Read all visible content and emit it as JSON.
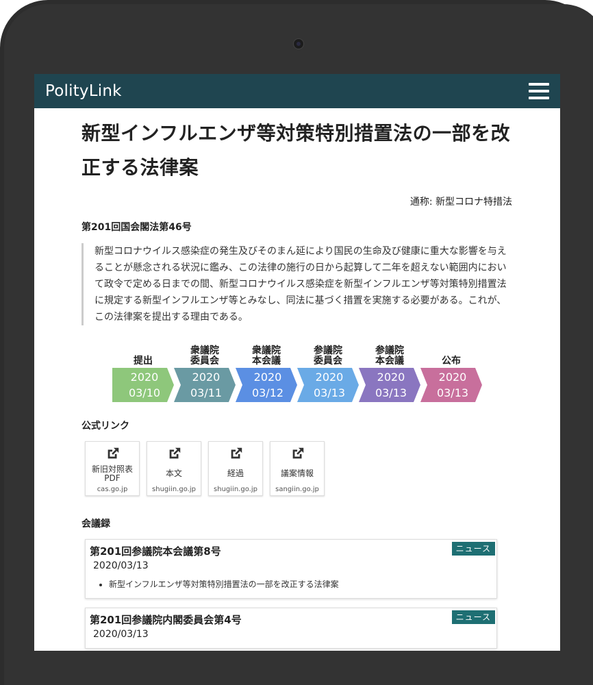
{
  "app": {
    "brand": "PolityLink",
    "menu_icon": "hamburger-menu-icon"
  },
  "bill": {
    "title": "新型インフルエンザ等対策特別措置法の一部を改正する法律案",
    "alias": "通称: 新型コロナ特措法",
    "number": "第201回国会閣法第46号",
    "reason": "新型コロナウイルス感染症の発生及びそのまん延により国民の生命及び健康に重大な影響を与えることが懸念される状況に鑑み、この法律の施行の日から起算して二年を超えない範囲内において政令で定める日までの間、新型コロナウイルス感染症を新型インフルエンザ等対策特別措置法に規定する新型インフルエンザ等とみなし、同法に基づく措置を実施する必要がある。これが、この法律案を提出する理由である。"
  },
  "timeline": [
    {
      "label": "提出",
      "year": "2020",
      "date": "03/10",
      "color": "#8ec77b"
    },
    {
      "label": "衆議院\n委員会",
      "year": "2020",
      "date": "03/11",
      "color": "#6a9aa3"
    },
    {
      "label": "衆議院\n本会議",
      "year": "2020",
      "date": "03/12",
      "color": "#5b8fe3"
    },
    {
      "label": "参議院\n委員会",
      "year": "2020",
      "date": "03/13",
      "color": "#6aaae6"
    },
    {
      "label": "参議院\n本会議",
      "year": "2020",
      "date": "03/13",
      "color": "#8a76c0"
    },
    {
      "label": "公布",
      "year": "2020",
      "date": "03/13",
      "color": "#c86f9c"
    }
  ],
  "official_links": {
    "title": "公式リンク",
    "icon": "external-link-icon",
    "items": [
      {
        "label": "新旧対照表\nPDF",
        "domain": "cas.go.jp"
      },
      {
        "label": "本文",
        "domain": "shugiin.go.jp"
      },
      {
        "label": "経過",
        "domain": "shugiin.go.jp"
      },
      {
        "label": "議案情報",
        "domain": "sangiin.go.jp"
      }
    ]
  },
  "meetings": {
    "title": "会議録",
    "items": [
      {
        "title": "第201回参議院本会議第8号",
        "date": "2020/03/13",
        "badge": "ニュース",
        "bills": [
          "新型インフルエンザ等対策特別措置法の一部を改正する法律案"
        ]
      },
      {
        "title": "第201回参議院内閣委員会第4号",
        "date": "2020/03/13",
        "badge": "ニュース",
        "bills": []
      }
    ]
  }
}
